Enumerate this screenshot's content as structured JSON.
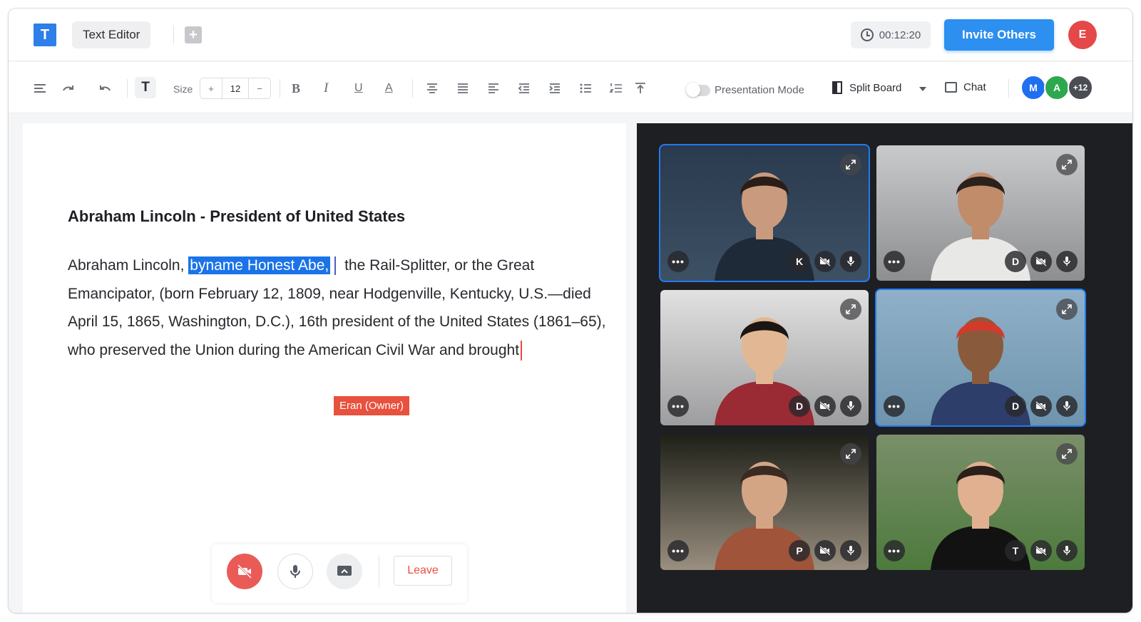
{
  "app": {
    "logo_letter": "T",
    "doc_tab_label": "Text Editor",
    "add_tab_symbol": "+",
    "timer": "00:12:20",
    "invite_label": "Invite Others",
    "user_initial": "E"
  },
  "toolbar": {
    "size_label": "Size",
    "size_plus": "+",
    "size_value": "12",
    "size_minus": "−",
    "text_style_letter": "T",
    "presentation_mode_label": "Presentation Mode",
    "presentation_mode_on": false,
    "split_board_label": "Split Board",
    "chat_label": "Chat",
    "participants": [
      {
        "initial": "M",
        "color": "#1f6ff0"
      },
      {
        "initial": "A",
        "color": "#2ea84f"
      },
      {
        "initial": "+12",
        "color": "#4a4d53"
      }
    ],
    "icons": [
      "align-left-icon",
      "redo-icon",
      "undo-icon",
      "bold-icon",
      "italic-icon",
      "underline-icon",
      "text-color-icon",
      "align-center-icon",
      "align-justify-icon",
      "align-left-2-icon",
      "outdent-icon",
      "indent-icon",
      "bullet-list-icon",
      "numbered-list-icon",
      "align-top-icon"
    ]
  },
  "editor": {
    "title": "Abraham Lincoln - President of United States",
    "body_before": "Abraham Lincoln, ",
    "body_selected": "byname Honest Abe,",
    "body_after": " the Rail-Splitter, or the Great Emancipator, (born February 12, 1809, near Hodgenville, Kentucky, U.S.—died April 15, 1865, Washington, D.C.), 16th president of the United States (1861–65), who preserved the Union during the American Civil War and brought",
    "remote_cursor_label": "Eran (Owner)",
    "selection_color": "#1a73e8",
    "remote_cursor_color": "#e8513d"
  },
  "call_controls": {
    "leave_label": "Leave"
  },
  "videos": [
    {
      "initial": "K",
      "active": true,
      "bg": [
        "#2a3a4f",
        "#3d5064"
      ],
      "skin": "#c99a7e",
      "hair": "#2a1d17",
      "shirt": "#1f2a38"
    },
    {
      "initial": "D",
      "active": false,
      "bg": [
        "#c9cacc",
        "#8d8e90"
      ],
      "skin": "#c08c6a",
      "hair": "#2c201b",
      "shirt": "#e8e8e6"
    },
    {
      "initial": "D",
      "active": false,
      "bg": [
        "#e1e1e1",
        "#9d9d9f"
      ],
      "skin": "#e2b894",
      "hair": "#1b1614",
      "shirt": "#9a2a33"
    },
    {
      "initial": "D",
      "active": true,
      "bg": [
        "#8fb0c8",
        "#6f94ad"
      ],
      "skin": "#8a5a3c",
      "hair": "#d43a2a",
      "shirt": "#2d3e6a"
    },
    {
      "initial": "P",
      "active": false,
      "bg": [
        "#1e2018",
        "#9a8f80"
      ],
      "skin": "#d4a585",
      "hair": "#3a2a22",
      "shirt": "#a0543a"
    },
    {
      "initial": "T",
      "active": false,
      "bg": [
        "#7a8f6a",
        "#4d7a3c"
      ],
      "skin": "#e0b090",
      "hair": "#2a1f19",
      "shirt": "#121212"
    }
  ]
}
